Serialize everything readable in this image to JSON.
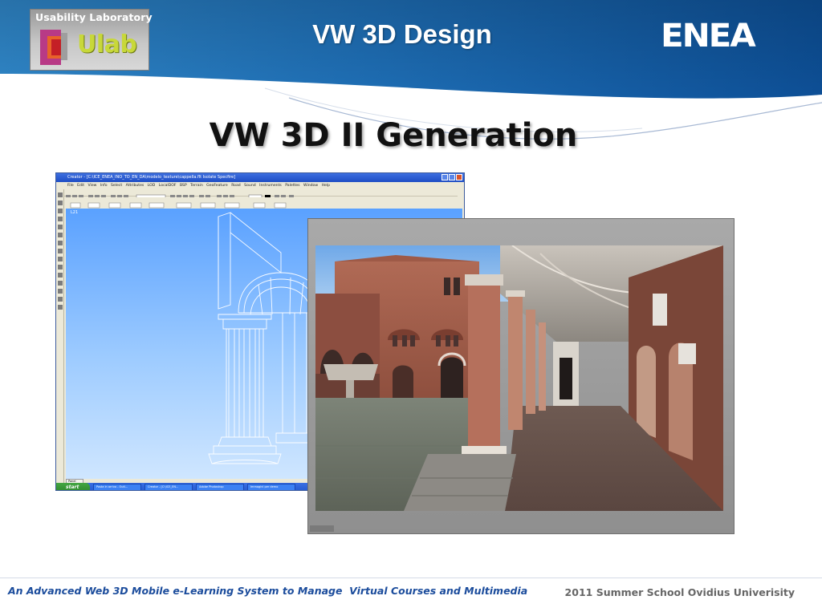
{
  "header": {
    "logo_caption": "Usability Laboratory",
    "logo_word": "Ulab",
    "title": "VW 3D Design",
    "partner_logo": "ENEA"
  },
  "main": {
    "title": "VW 3D II Generation"
  },
  "creator_window": {
    "title": "Creator - [C:\\ICE_ENEA_INO_TO_EN_DA\\modelo_texture\\cappella.flt Isolate Specfire]",
    "menu": "File  Edit  View  Info  Select  Attributes  LOD  LocalDOF  BSP  Terrain  GeoFeature  Road  Sound  Instruments  Palettes  Window  Help",
    "viewport_label": "L21",
    "panel_tab": "Panel",
    "taskbar": {
      "start": "start",
      "items": [
        "Posta in arrivo - Outl...",
        "Creator - [C:\\ICE_EN...",
        "Adobe Photoshop",
        "Immagini per demo"
      ]
    }
  },
  "footer": {
    "left": "An Advanced Web 3D Mobile e-Learning System to Manage  Virtual Courses and Multimedia",
    "right": "2011 Summer School Ovidius Univerisity"
  },
  "colors": {
    "header_blue": "#1f6fb6",
    "footer_blue": "#1b4c9c",
    "logo_green": "#c8d83a"
  }
}
